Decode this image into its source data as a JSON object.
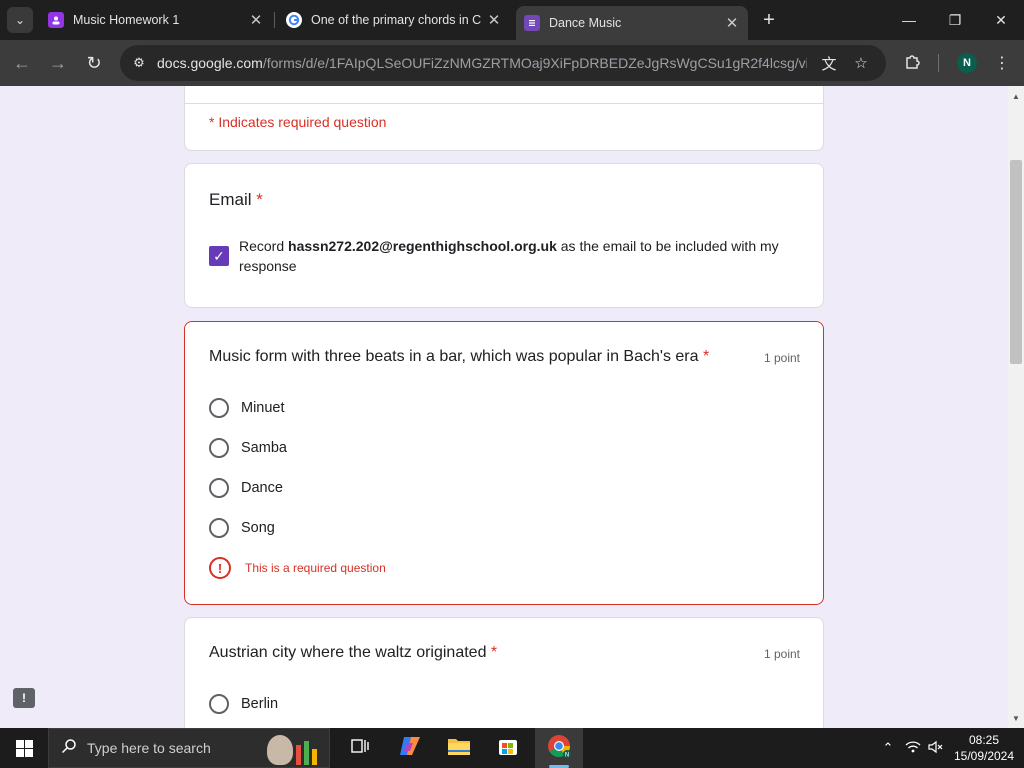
{
  "browser": {
    "tabs": [
      {
        "label": "Music Homework 1",
        "active": false
      },
      {
        "label": "One of the primary chords in C",
        "active": false
      },
      {
        "label": "Dance Music",
        "active": true
      }
    ],
    "url_host": "docs.google.com",
    "url_path": "/forms/d/e/1FAIpQLSeOUFiZzNMGZRTMOaj9XiFpDRBEDZeJgRsWgCSu1gR2f4lcsg/viewf...",
    "profile_initial": "N",
    "accent": "#673ab7",
    "error_color": "#d93025"
  },
  "form": {
    "required_note": "* Indicates required question",
    "email_section": {
      "title": "Email",
      "required_star": "*",
      "record_prefix": "Record",
      "email": "hassn272.202@regenthighschool.org.uk",
      "record_suffix": "as the email to be included with my response",
      "checked": true
    },
    "questions": [
      {
        "title": "Music form with three beats in a bar, which was popular in Bach's era",
        "required_star": "*",
        "points": "1 point",
        "options": [
          "Minuet",
          "Samba",
          "Dance",
          "Song"
        ],
        "error": "This is a required question"
      },
      {
        "title": "Austrian city where the waltz originated",
        "required_star": "*",
        "points": "1 point",
        "options": [
          "Berlin"
        ]
      }
    ]
  },
  "taskbar": {
    "search_placeholder": "Type here to search",
    "time": "08:25",
    "date": "15/09/2024",
    "chrome_badge": "N"
  },
  "icons": {
    "tab_search": "chevron-down-icon",
    "tab_close": "close-icon",
    "new_tab": "plus-icon",
    "minimize": "minimize-icon",
    "restore": "restore-icon",
    "close_window": "close-icon",
    "back": "arrow-left-icon",
    "forward": "arrow-right-icon",
    "reload": "reload-icon",
    "translate": "translate-icon",
    "bookmark": "star-icon",
    "extensions": "puzzle-icon",
    "menu": "kebab-menu-icon"
  }
}
